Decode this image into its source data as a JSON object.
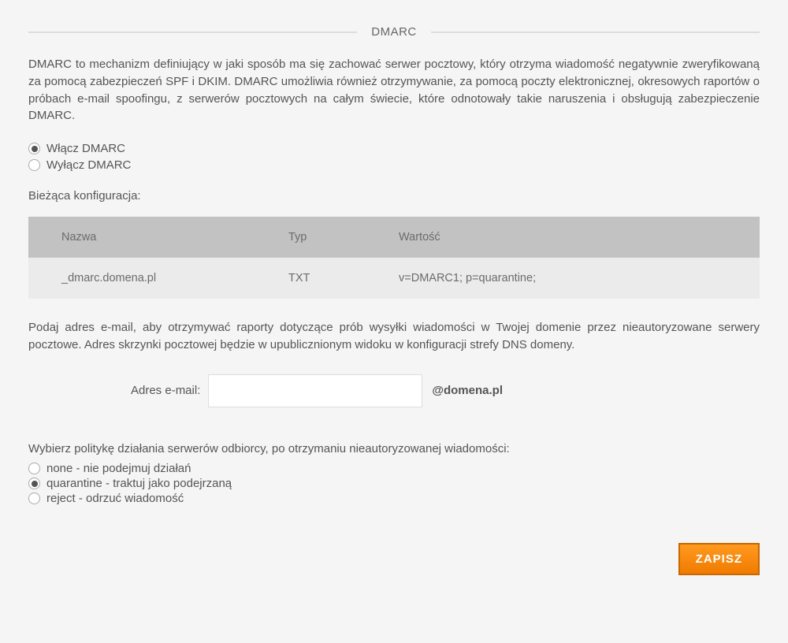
{
  "section": {
    "title": "DMARC",
    "description": "DMARC to mechanizm definiujący w jaki sposób ma się zachować serwer pocztowy, który otrzyma wiadomość negatywnie zweryfikowaną za pomocą zabezpieczeń SPF i DKIM. DMARC umożliwia również otrzymywanie, za pomocą poczty elektronicznej, okresowych raportów o próbach e-mail spoofingu, z serwerów pocztowych na całym świecie, które odnotowały takie naruszenia i obsługują zabezpieczenie DMARC."
  },
  "toggle": {
    "enable_label": "Włącz DMARC",
    "disable_label": "Wyłącz DMARC",
    "selected": "enable"
  },
  "config": {
    "heading": "Bieżąca konfiguracja:",
    "columns": {
      "name": "Nazwa",
      "type": "Typ",
      "value": "Wartość"
    },
    "rows": [
      {
        "name": "_dmarc.domena.pl",
        "type": "TXT",
        "value": "v=DMARC1; p=quarantine;"
      }
    ]
  },
  "email": {
    "description": "Podaj adres e-mail, aby otrzymywać raporty dotyczące prób wysyłki wiadomości w Twojej domenie przez nieautoryzowane serwery pocztowe. Adres skrzynki pocztowej będzie w upublicznionym widoku w konfiguracji strefy DNS domeny.",
    "label": "Adres e-mail:",
    "value": "",
    "suffix": "@domena.pl"
  },
  "policy": {
    "heading": "Wybierz politykę działania serwerów odbiorcy, po otrzymaniu nieautoryzowanej wiadomości:",
    "selected": "quarantine",
    "options": {
      "none": "none - nie podejmuj działań",
      "quarantine": "quarantine - traktuj jako podejrzaną",
      "reject": "reject - odrzuć wiadomość"
    }
  },
  "actions": {
    "save": "ZAPISZ"
  }
}
